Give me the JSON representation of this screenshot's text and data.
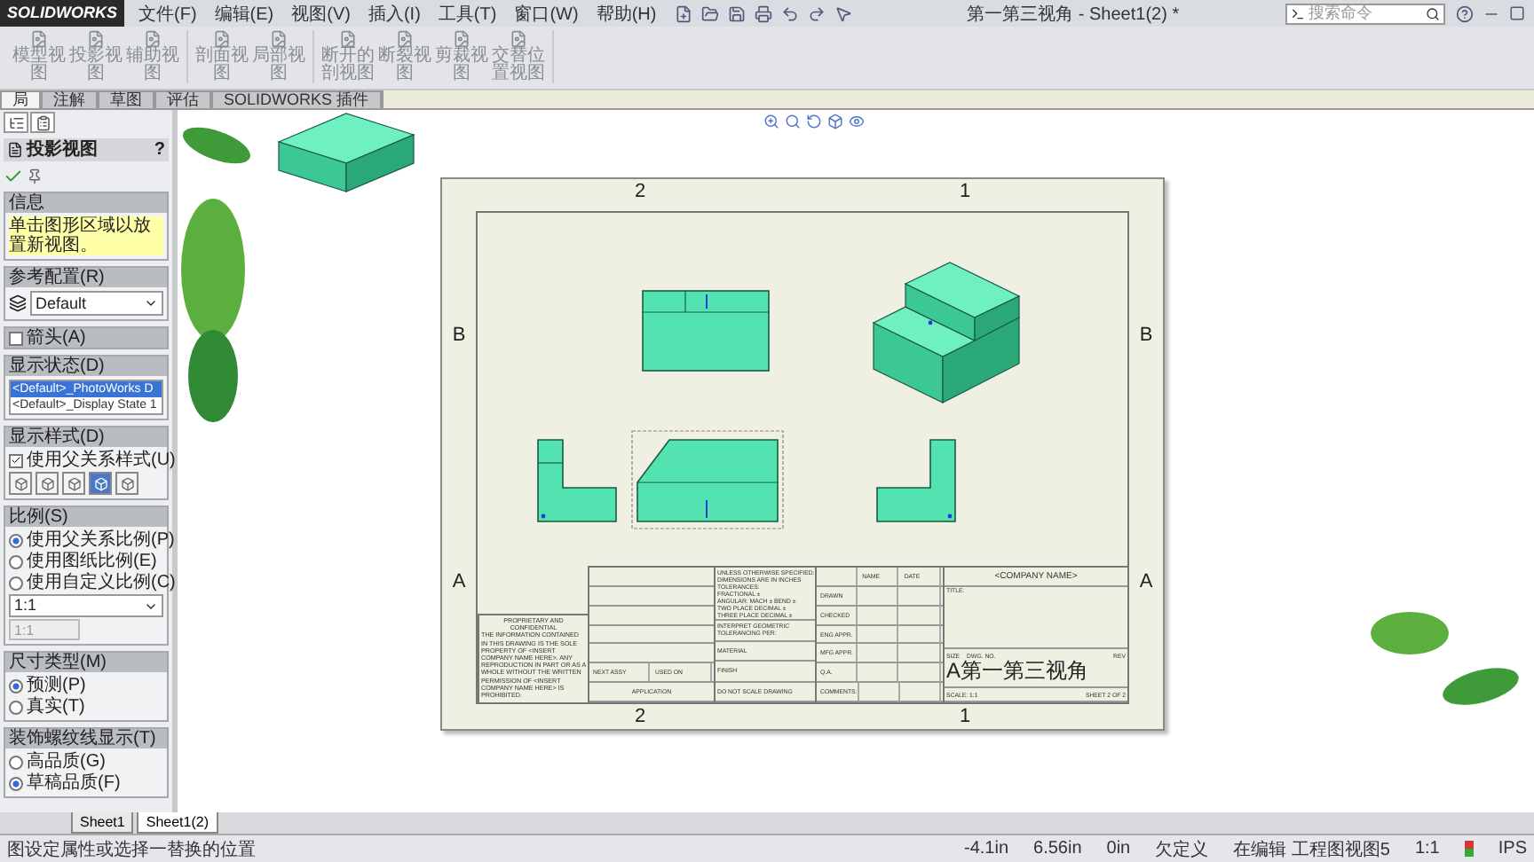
{
  "window": {
    "app": "SOLIDWORKS",
    "title": "第一第三视角 - Sheet1(2) *"
  },
  "menu": [
    "文件(F)",
    "编辑(E)",
    "视图(V)",
    "插入(I)",
    "工具(T)",
    "窗口(W)",
    "帮助(H)"
  ],
  "search": {
    "placeholder": "搜索命令"
  },
  "toolbar": [
    [
      "模型视图",
      "投影视图",
      "辅助视图"
    ],
    [
      "剖面视图",
      "局部视图"
    ],
    [
      "断开的剖视图",
      "断裂视图",
      "剪裁视图",
      "交替位置视图"
    ]
  ],
  "ribbon_tabs": [
    {
      "label": "局",
      "selected": true
    },
    {
      "label": "注解",
      "selected": false
    },
    {
      "label": "草图",
      "selected": false
    },
    {
      "label": "评估",
      "selected": false
    },
    {
      "label": "SOLIDWORKS 插件",
      "selected": false
    }
  ],
  "panel": {
    "title": "投影视图",
    "help": "?",
    "message": {
      "title": "信息",
      "text": "单击图形区域以放置新视图。"
    },
    "config": {
      "title": "参考配置(R)",
      "value": "Default"
    },
    "arrow": {
      "title": "箭头(A)",
      "checked": false
    },
    "display_state": {
      "title": "显示状态(D)",
      "items": [
        {
          "label": "<Default>_PhotoWorks D",
          "selected": true
        },
        {
          "label": "<Default>_Display State 1",
          "selected": false
        }
      ]
    },
    "display_style": {
      "title": "显示样式(D)",
      "use_parent": {
        "label": "使用父关系样式(U)",
        "checked": true
      },
      "styles": [
        {
          "selected": false
        },
        {
          "selected": false
        },
        {
          "selected": false
        },
        {
          "selected": true
        },
        {
          "selected": false
        }
      ]
    },
    "scale": {
      "title": "比例(S)",
      "options": [
        {
          "label": "使用父关系比例(P)",
          "selected": true
        },
        {
          "label": "使用图纸比例(E)",
          "selected": false
        },
        {
          "label": "使用自定义比例(C)",
          "selected": false
        }
      ],
      "dropdown": "1:1",
      "field": "1:1"
    },
    "dim_type": {
      "title": "尺寸类型(M)",
      "options": [
        {
          "label": "预测(P)",
          "selected": true
        },
        {
          "label": "真实(T)",
          "selected": false
        }
      ]
    },
    "thread": {
      "title": "装饰螺纹线显示(T)",
      "options": [
        {
          "label": "高品质(G)",
          "selected": false
        },
        {
          "label": "草稿品质(F)",
          "selected": true
        }
      ]
    }
  },
  "sheet": {
    "top_labels": [
      "2",
      "1"
    ],
    "bottom_labels": [
      "2",
      "1"
    ],
    "left_labels": [
      "B",
      "A"
    ],
    "right_labels": [
      "B",
      "A"
    ],
    "title_block": {
      "notes_heading": "PROPRIETARY AND CONFIDENTIAL",
      "notes": "THE INFORMATION CONTAINED IN THIS DRAWING IS THE SOLE PROPERTY OF <INSERT COMPANY NAME HERE>. ANY REPRODUCTION IN PART OR AS A WHOLE WITHOUT THE WRITTEN PERMISSION OF <INSERT COMPANY NAME HERE> IS PROHIBITED.",
      "next_assy": "NEXT ASSY",
      "used_on": "USED ON",
      "application": "APPLICATION",
      "tolerances": [
        "UNLESS OTHERWISE SPECIFIED:",
        "DIMENSIONS ARE IN INCHES",
        "TOLERANCES:",
        "FRACTIONAL ±",
        "ANGULAR: MACH ±   BEND ±",
        "TWO PLACE DECIMAL   ±",
        "THREE PLACE DECIMAL   ±"
      ],
      "interpret": "INTERPRET GEOMETRIC TOLERANCING PER:",
      "material": "MATERIAL",
      "finish": "FINISH",
      "do_not_scale": "DO NOT SCALE DRAWING",
      "name": "NAME",
      "date": "DATE",
      "signoffs": [
        "DRAWN",
        "CHECKED",
        "ENG APPR.",
        "MFG APPR.",
        "Q.A.",
        "COMMENTS:"
      ],
      "company": "<COMPANY NAME>",
      "title": "TITLE:",
      "size_label": "SIZE",
      "dwg_label": "DWG.  NO.",
      "rev_label": "REV",
      "size": "A",
      "dwg_no": "第一第三视角",
      "scale": "SCALE: 1:1",
      "sheet": "SHEET 2 OF 2"
    }
  },
  "sheet_tabs": [
    {
      "label": "Sheet1",
      "selected": false
    },
    {
      "label": "Sheet1(2)",
      "selected": true
    }
  ],
  "status": {
    "hint": "图设定属性或选择一替换的位置",
    "x": "-4.1in",
    "y": "6.56in",
    "z": "0in",
    "state": "欠定义",
    "mode": "在编辑 工程图视图5",
    "scale": "1:1",
    "units": "IPS"
  }
}
